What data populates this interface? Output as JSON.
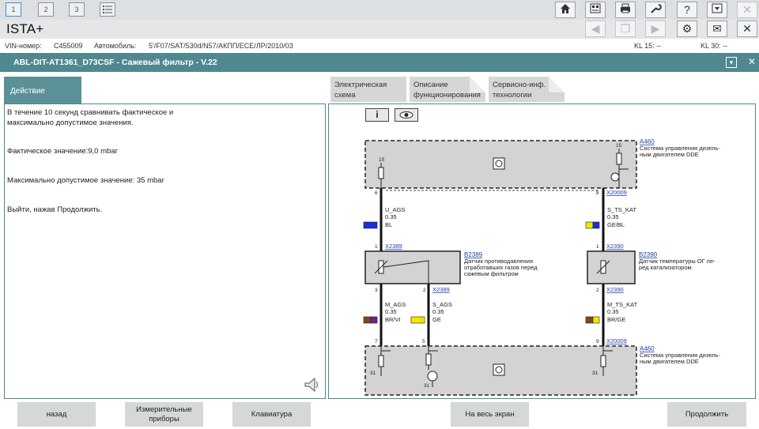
{
  "toolbar": {
    "tabs": [
      "1",
      "2",
      "3"
    ]
  },
  "app": {
    "title": "ISTA+"
  },
  "vehicle": {
    "vin_label": "VIN-номер:",
    "vin_value": "C455009",
    "car_label": "Автомобиль:",
    "car_value": "5'/F07/SAT/530d/N57/АКПП/ECE/ЛР/2010/03",
    "kl15": "KL 15:  --",
    "kl30": "KL 30:  --"
  },
  "test": {
    "title": "ABL-DIT-AT1361_D73CSF - Сажевый фильтр - V.22"
  },
  "left_tab": "Действие",
  "right_tabs": [
    {
      "line1": "Электрическая",
      "line2": "схема"
    },
    {
      "line1": "Описание",
      "line2": "функционирования"
    },
    {
      "line1": "Сервисно-инф.",
      "line2": "технологии"
    }
  ],
  "instructions": {
    "line1": "В течение 10 секунд сравнивать фактическое и",
    "line2": "максимально допустимое значения.",
    "actual": "Фактическое значение:9,0 mbar",
    "max": "Максимально допустимое значение: 35 mbar",
    "exit": "Выйти, нажав Продолжить."
  },
  "diagram": {
    "a460": "A460",
    "a460_desc1": "Система управления дизель-",
    "a460_desc2": "ным двигателем DDE",
    "pin15": "15",
    "pin31": "31",
    "pin6": "6",
    "pin8": "8",
    "pin1": "1",
    "pin2": "2",
    "pin3": "3",
    "pin7": "7",
    "pin5": "5",
    "pin9": "9",
    "x20009": "X20009",
    "x2389": "X2389",
    "x2390": "X2390",
    "w1_name": "U_AGS",
    "w1_size": "0.35",
    "w1_color": "BL",
    "w2_name": "S_TS_KAT",
    "w2_size": "0.35",
    "w2_color": "GE/BL",
    "w3_name": "M_AGS",
    "w3_size": "0.35",
    "w3_color": "BR/VI",
    "w4_name": "S_AGS",
    "w4_size": "0.35",
    "w4_color": "GE",
    "w5_name": "M_TS_KAT",
    "w5_size": "0.35",
    "w5_color": "BR/GE",
    "b2389": "B2389",
    "b2389_d1": "Датчик противодавления",
    "b2389_d2": "отработавших газов перед",
    "b2389_d3": "сажевым фильтром",
    "b2390": "B2390",
    "b2390_d1": "Датчик температуры ОГ пе-",
    "b2390_d2": "ред катализатором",
    "info_btn": "i"
  },
  "buttons": {
    "back": "назад",
    "meters_line1": "Измерительные",
    "meters_line2": "приборы",
    "keyboard": "Клавиатура",
    "fullscreen": "На весь экран",
    "continue": "Продолжить"
  },
  "colors": {
    "header": "#4f888e",
    "blue": "#1b2fd6",
    "yellow": "#f2e600",
    "brown": "#7a4a1d",
    "violet": "#7a1b8a"
  }
}
